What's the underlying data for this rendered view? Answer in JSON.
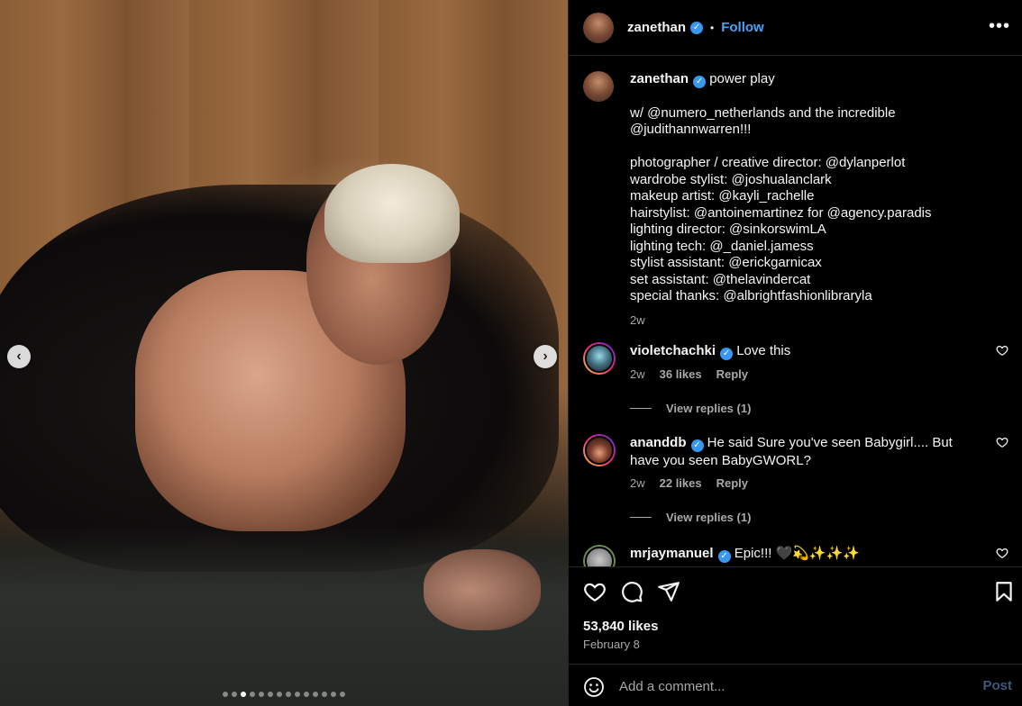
{
  "post": {
    "username": "zanethan",
    "separator": "•",
    "follow_label": "Follow",
    "more_label": "•••",
    "carousel": {
      "prev": "‹",
      "next": "›",
      "slide_count": 14,
      "active_index": 2
    }
  },
  "caption": {
    "username": "zanethan",
    "lines": [
      "power play",
      "",
      "w/ @numero_netherlands and the incredible",
      "@judithannwarren!!!",
      "",
      "photographer / creative director: @dylanperlot",
      "wardrobe stylist: @joshualanclark",
      "makeup artist: @kayli_rachelle",
      "hairstylist: @antoinemartinez for @agency.paradis",
      "lighting director: @sinkorswimLA",
      "lighting tech: @_daniel.jamess",
      "stylist assistant: @erickgarnicax",
      "set assistant: @thelavindercat",
      "special thanks: @albrightfashionlibraryla"
    ],
    "time": "2w"
  },
  "comments": [
    {
      "username": "violetchachki",
      "text": "Love this",
      "time": "2w",
      "likes": "36 likes",
      "reply": "Reply",
      "view_replies": "View replies (1)"
    },
    {
      "username": "ananddb",
      "text": "He said Sure you've seen Babygirl.... But have you seen BabyGWORL?",
      "time": "2w",
      "likes": "22 likes",
      "reply": "Reply",
      "view_replies": "View replies (1)"
    },
    {
      "username": "mrjaymanuel",
      "text": "Epic!!! 🖤💫✨✨✨"
    }
  ],
  "actions": {
    "likes": "53,840 likes",
    "date": "February 8"
  },
  "composer": {
    "placeholder": "Add a comment...",
    "post_label": "Post"
  },
  "colors": {
    "background": "#000000",
    "link": "#4aa3f5",
    "verified": "#3897f0",
    "muted": "#a8a8a8"
  }
}
